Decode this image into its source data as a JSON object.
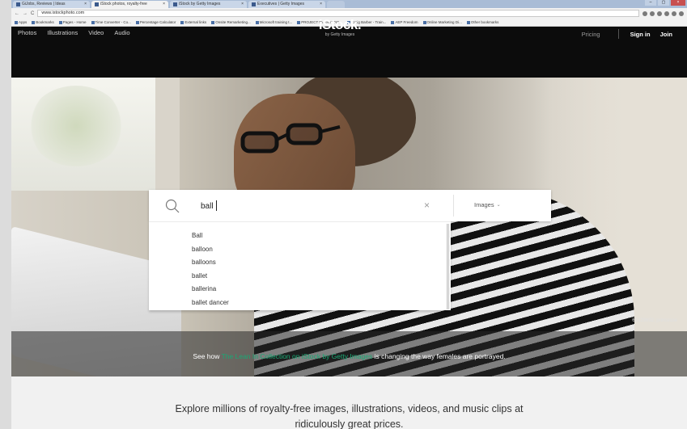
{
  "browser": {
    "tabs": [
      {
        "label": "GiJobs, Reviews | Ideas"
      },
      {
        "label": "iStock photos, royalty-free"
      },
      {
        "label": "iStock by Getty Images"
      },
      {
        "label": "Executives | Getty Images"
      }
    ],
    "active_tab": 1,
    "url": "www.istockphoto.com",
    "bookmarks": [
      "Apps",
      "Bookmarks",
      "Pages - Home",
      "Time Converter - Co...",
      "Percentage Calculator",
      "External links",
      "Onsite Remarketing...",
      "Microsoft training t...",
      "PROJECT EVERYONE...",
      "Craig Barber - Train...",
      "AEP Freedom",
      "Online Marketing Di...",
      "Other bookmarks"
    ]
  },
  "header": {
    "nav_left": [
      "Photos",
      "Illustrations",
      "Video",
      "Audio"
    ],
    "logo": {
      "brand": "iStock.",
      "sub": "by Getty Images"
    },
    "pricing": "Pricing",
    "sign_in": "Sign in",
    "join": "Join"
  },
  "search": {
    "query": "ball",
    "type": "Images",
    "suggestions": [
      "Ball",
      "balloon",
      "balloons",
      "ballet",
      "ballerina",
      "ballet dancer"
    ]
  },
  "hero": {
    "credit": "61329892, princesse",
    "promo_prefix": "See how ",
    "promo_link": "The Lean In Collection on iStock by Getty Images",
    "promo_suffix": " is changing the way females are portrayed."
  },
  "tagline": {
    "line1": "Explore millions of royalty-free images, illustrations, videos, and music clips at",
    "line2": "ridiculously great prices."
  },
  "colors": {
    "accent_green": "#19a974",
    "header_bg": "#0c0c0c"
  }
}
